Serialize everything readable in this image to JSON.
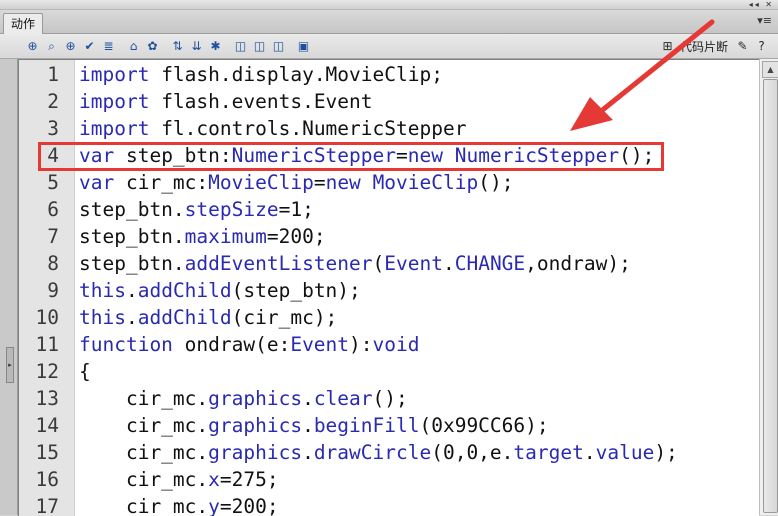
{
  "window": {
    "controls": "◂◂ ✕"
  },
  "panel": {
    "tab_label": "动作",
    "menu_glyph": "▾≡"
  },
  "toolbar": {
    "icons": [
      {
        "name": "add-statement-icon",
        "glyph": "⊕"
      },
      {
        "name": "find-icon",
        "glyph": "⌕"
      },
      {
        "name": "insert-target-path-icon",
        "glyph": "⊕"
      },
      {
        "name": "check-syntax-icon",
        "glyph": "✔"
      },
      {
        "name": "auto-format-icon",
        "glyph": "≣"
      },
      {
        "name": "show-code-hint-icon",
        "glyph": "⌂"
      },
      {
        "name": "debug-options-icon",
        "glyph": "✿"
      },
      {
        "name": "collapse-between-braces-icon",
        "glyph": "⇅"
      },
      {
        "name": "collapse-selection-icon",
        "glyph": "⇊"
      },
      {
        "name": "expand-all-icon",
        "glyph": "✱"
      },
      {
        "name": "apply-block-comment-icon",
        "glyph": "◫"
      },
      {
        "name": "apply-line-comment-icon",
        "glyph": "◫"
      },
      {
        "name": "remove-comment-icon",
        "glyph": "◫"
      },
      {
        "name": "show-hide-toolbox-icon",
        "glyph": "▣"
      }
    ],
    "code_snippets_label": "代码片断",
    "right_icons": [
      {
        "name": "code-snippets-icon",
        "glyph": "⊞"
      },
      {
        "name": "script-assist-icon",
        "glyph": "✎"
      },
      {
        "name": "help-icon",
        "glyph": "?"
      }
    ]
  },
  "editor": {
    "lines": [
      {
        "n": "1",
        "html": "<span class='kw'>import</span> flash.display.MovieClip;"
      },
      {
        "n": "2",
        "html": "<span class='kw'>import</span> flash.events.Event"
      },
      {
        "n": "3",
        "html": "<span class='kw'>import</span> fl.controls.NumericStepper"
      },
      {
        "n": "4",
        "html": "<span class='kw'>var</span> step_btn:<span class='tp'>NumericStepper</span>=<span class='kw'>new</span> <span class='tp'>NumericStepper</span>();"
      },
      {
        "n": "5",
        "html": "<span class='kw'>var</span> cir_mc:<span class='tp'>MovieClip</span>=<span class='kw'>new</span> <span class='tp'>MovieClip</span>();"
      },
      {
        "n": "6",
        "html": "step_btn.<span class='fn'>stepSize</span>=1;"
      },
      {
        "n": "7",
        "html": "step_btn.<span class='fn'>maximum</span>=200;"
      },
      {
        "n": "8",
        "html": "step_btn.<span class='fn'>addEventListener</span>(<span class='tp'>Event</span>.<span class='tp'>CHANGE</span>,ondraw);"
      },
      {
        "n": "9",
        "html": "<span class='kw'>this</span>.<span class='fn'>addChild</span>(step_btn);"
      },
      {
        "n": "10",
        "html": "<span class='kw'>this</span>.<span class='fn'>addChild</span>(cir_mc);"
      },
      {
        "n": "11",
        "html": "<span class='kw'>function</span> ondraw(e:<span class='tp'>Event</span>):<span class='kw'>void</span>"
      },
      {
        "n": "12",
        "html": "{"
      },
      {
        "n": "13",
        "html": "    cir_mc.<span class='fn'>graphics</span>.<span class='fn'>clear</span>();"
      },
      {
        "n": "14",
        "html": "    cir_mc.<span class='fn'>graphics</span>.<span class='fn'>beginFill</span>(0x99CC66);"
      },
      {
        "n": "15",
        "html": "    cir_mc.<span class='fn'>graphics</span>.<span class='fn'>drawCircle</span>(0,0,e.<span class='fn'>target</span>.<span class='fn'>value</span>);"
      },
      {
        "n": "16",
        "html": "    cir_mc.<span class='fn'>x</span>=275;"
      },
      {
        "n": "17",
        "html": "    cir_mc.<span class='fn'>y</span>=200;"
      }
    ],
    "highlighted_line": "4"
  },
  "colors": {
    "annotation_red": "#e53935",
    "keyword_blue": "#2a2ab0"
  }
}
